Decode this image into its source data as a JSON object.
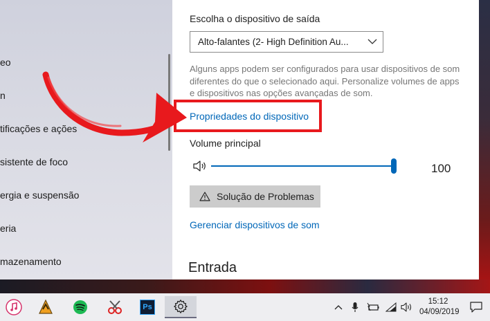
{
  "navigation": {
    "items": [
      {
        "label": "eo"
      },
      {
        "label": "n"
      },
      {
        "label": "tificações e ações"
      },
      {
        "label": "sistente de foco"
      },
      {
        "label": "ergia e suspensão"
      },
      {
        "label": "eria"
      },
      {
        "label": "mazenamento"
      }
    ]
  },
  "output": {
    "heading": "Escolha o dispositivo de saída",
    "device_selected": "Alto-falantes (2- High Definition Au...",
    "help_text": "Alguns apps podem ser configurados para usar dispositivos de som diferentes do que o selecionado aqui. Personalize volumes de apps e dispositivos nas opções avançadas de som.",
    "device_properties_link": "Propriedades do dispositivo",
    "volume_label": "Volume principal",
    "volume_value": "100",
    "volume_level": 1.0,
    "troubleshoot_label": "Solução de Problemas",
    "manage_devices_link": "Gerenciar dispositivos de som"
  },
  "input": {
    "heading": "Entrada"
  },
  "taskbar": {
    "apps": [
      {
        "icon": "itunes-icon"
      },
      {
        "icon": "winamp-icon"
      },
      {
        "icon": "spotify-icon"
      },
      {
        "icon": "snipping-tool-icon"
      },
      {
        "icon": "photoshop-icon",
        "text": "Ps"
      },
      {
        "icon": "settings-gear-icon"
      }
    ],
    "time": "15:12",
    "date": "04/09/2019"
  },
  "colors": {
    "accent": "#0067b8",
    "highlight_red": "#e8191d"
  }
}
